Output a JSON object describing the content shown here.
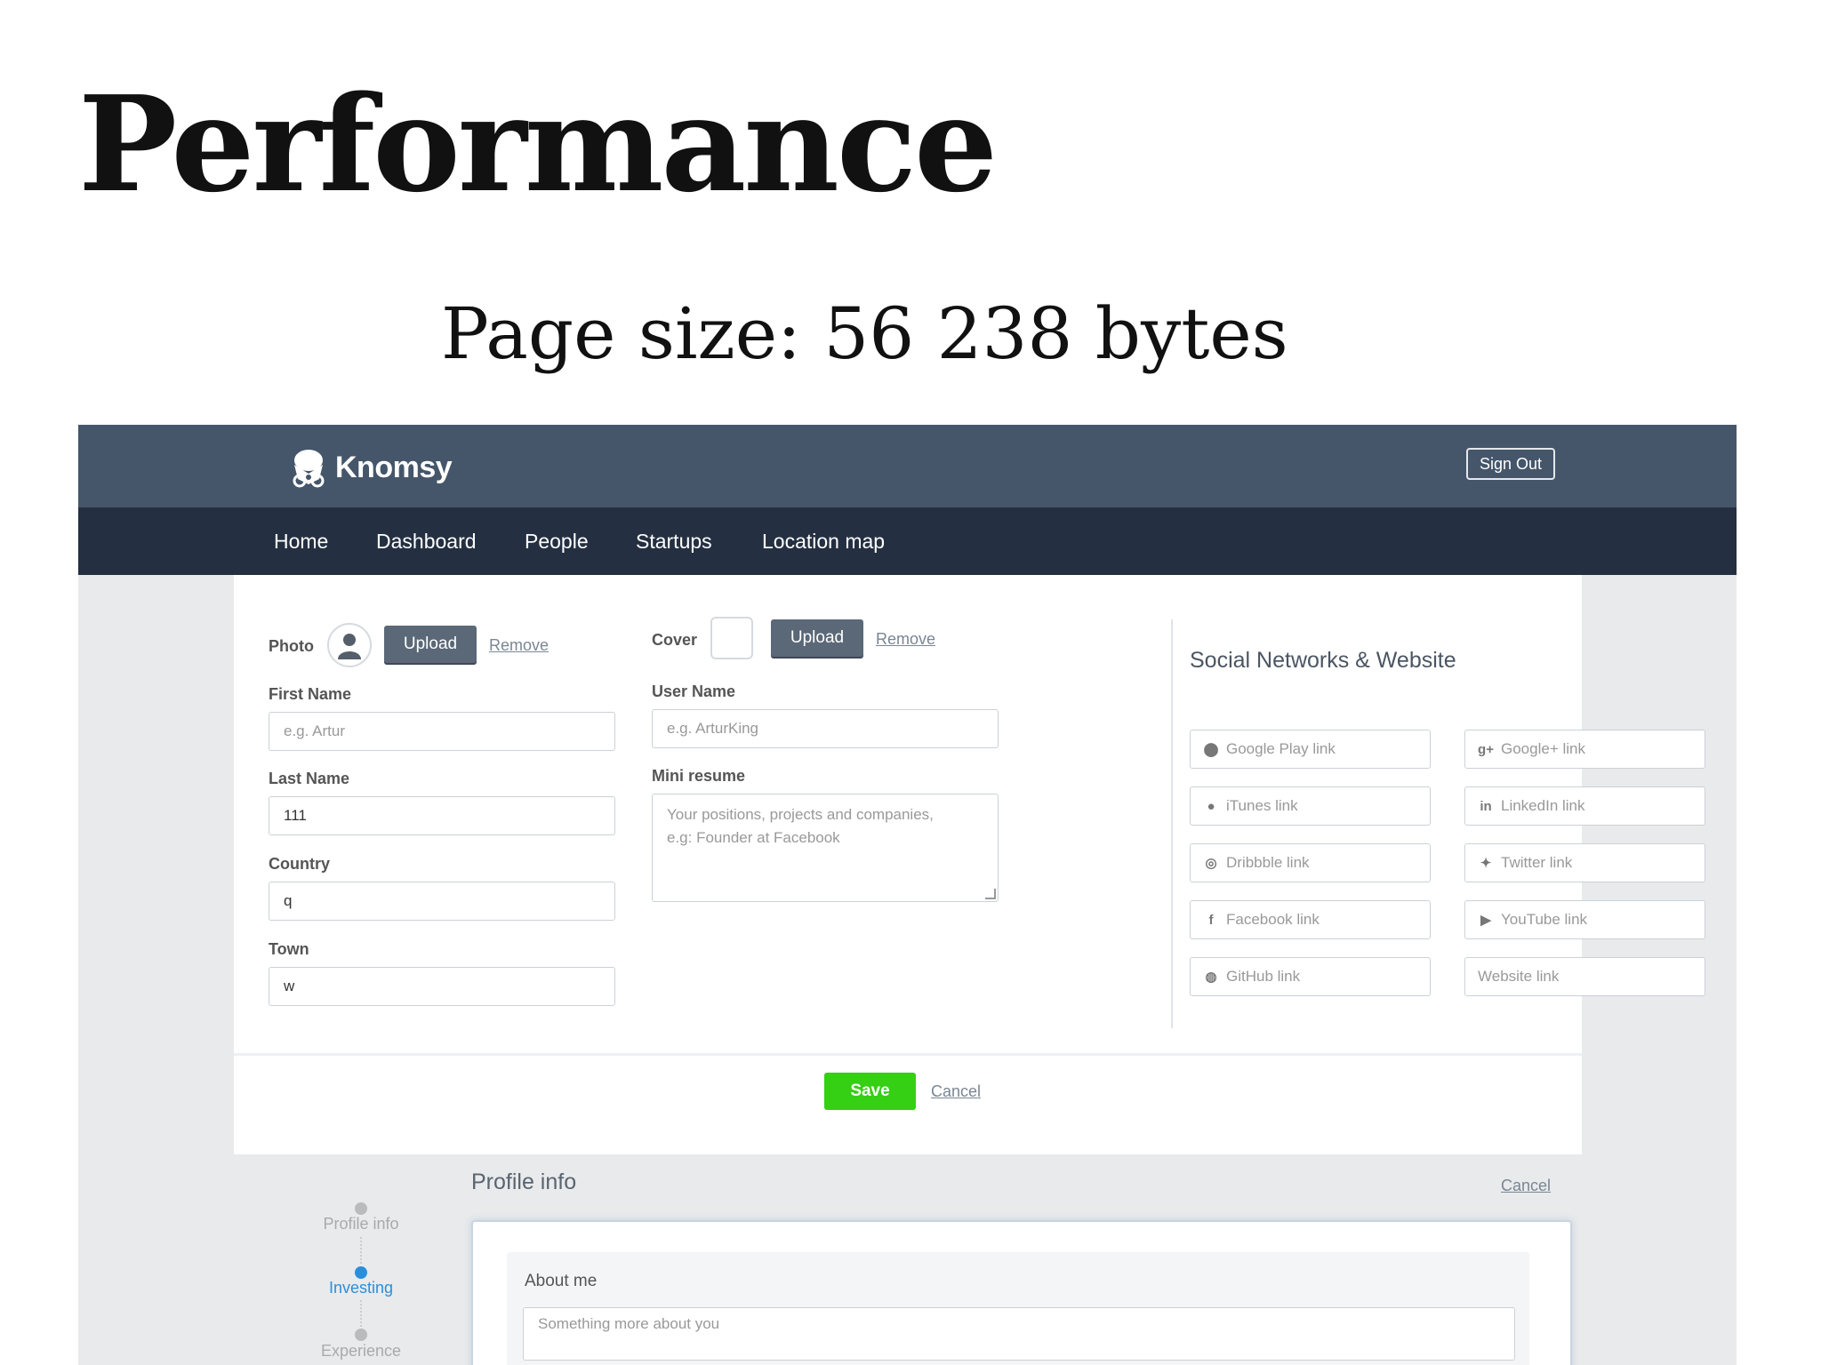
{
  "slide": {
    "title": "Performance",
    "subtitle": "Page size: 56 238 bytes"
  },
  "app": {
    "brand": "Knomsy",
    "sign_out": "Sign Out",
    "nav": [
      "Home",
      "Dashboard",
      "People",
      "Startups",
      "Location map"
    ]
  },
  "form": {
    "photo_label": "Photo",
    "cover_label": "Cover",
    "upload_label": "Upload",
    "remove_label": "Remove",
    "first_name": {
      "label": "First Name",
      "placeholder": "e.g. Artur"
    },
    "last_name": {
      "label": "Last Name",
      "value": "111"
    },
    "country": {
      "label": "Country",
      "value": "q"
    },
    "town": {
      "label": "Town",
      "value": "w"
    },
    "user_name": {
      "label": "User Name",
      "placeholder": "e.g. ArturKing"
    },
    "mini_resume": {
      "label": "Mini resume",
      "placeholder_line1": "Your positions, projects and companies,",
      "placeholder_line2": "e.g: Founder at Facebook"
    },
    "social_title": "Social Networks & Website",
    "social": [
      {
        "icon": "android-icon",
        "glyph": "⬤",
        "placeholder": "Google Play link"
      },
      {
        "icon": "google-plus-icon",
        "glyph": "g+",
        "placeholder": "Google+ link"
      },
      {
        "icon": "apple-icon",
        "glyph": "●",
        "placeholder": "iTunes link"
      },
      {
        "icon": "linkedin-icon",
        "glyph": "in",
        "placeholder": "LinkedIn link"
      },
      {
        "icon": "dribbble-icon",
        "glyph": "◎",
        "placeholder": "Dribbble link"
      },
      {
        "icon": "twitter-icon",
        "glyph": "✦",
        "placeholder": "Twitter link"
      },
      {
        "icon": "facebook-icon",
        "glyph": "f",
        "placeholder": "Facebook link"
      },
      {
        "icon": "youtube-icon",
        "glyph": "▶",
        "placeholder": "YouTube link"
      },
      {
        "icon": "github-icon",
        "glyph": "◍",
        "placeholder": "GitHub link"
      },
      {
        "icon": "",
        "glyph": "",
        "placeholder": "Website link"
      }
    ],
    "save_label": "Save",
    "cancel_label": "Cancel"
  },
  "wizard": {
    "title": "Profile info",
    "cancel_label": "Cancel",
    "about_label": "About me",
    "about_placeholder": "Something more about you",
    "steps": [
      {
        "label": "Profile info",
        "active": false
      },
      {
        "label": "Investing",
        "active": true
      },
      {
        "label": "Experience",
        "active": false
      }
    ]
  },
  "colors": {
    "topbar": "#45566a",
    "navbar": "#243041",
    "save": "#35cf14",
    "active_step": "#2a8fdb"
  }
}
